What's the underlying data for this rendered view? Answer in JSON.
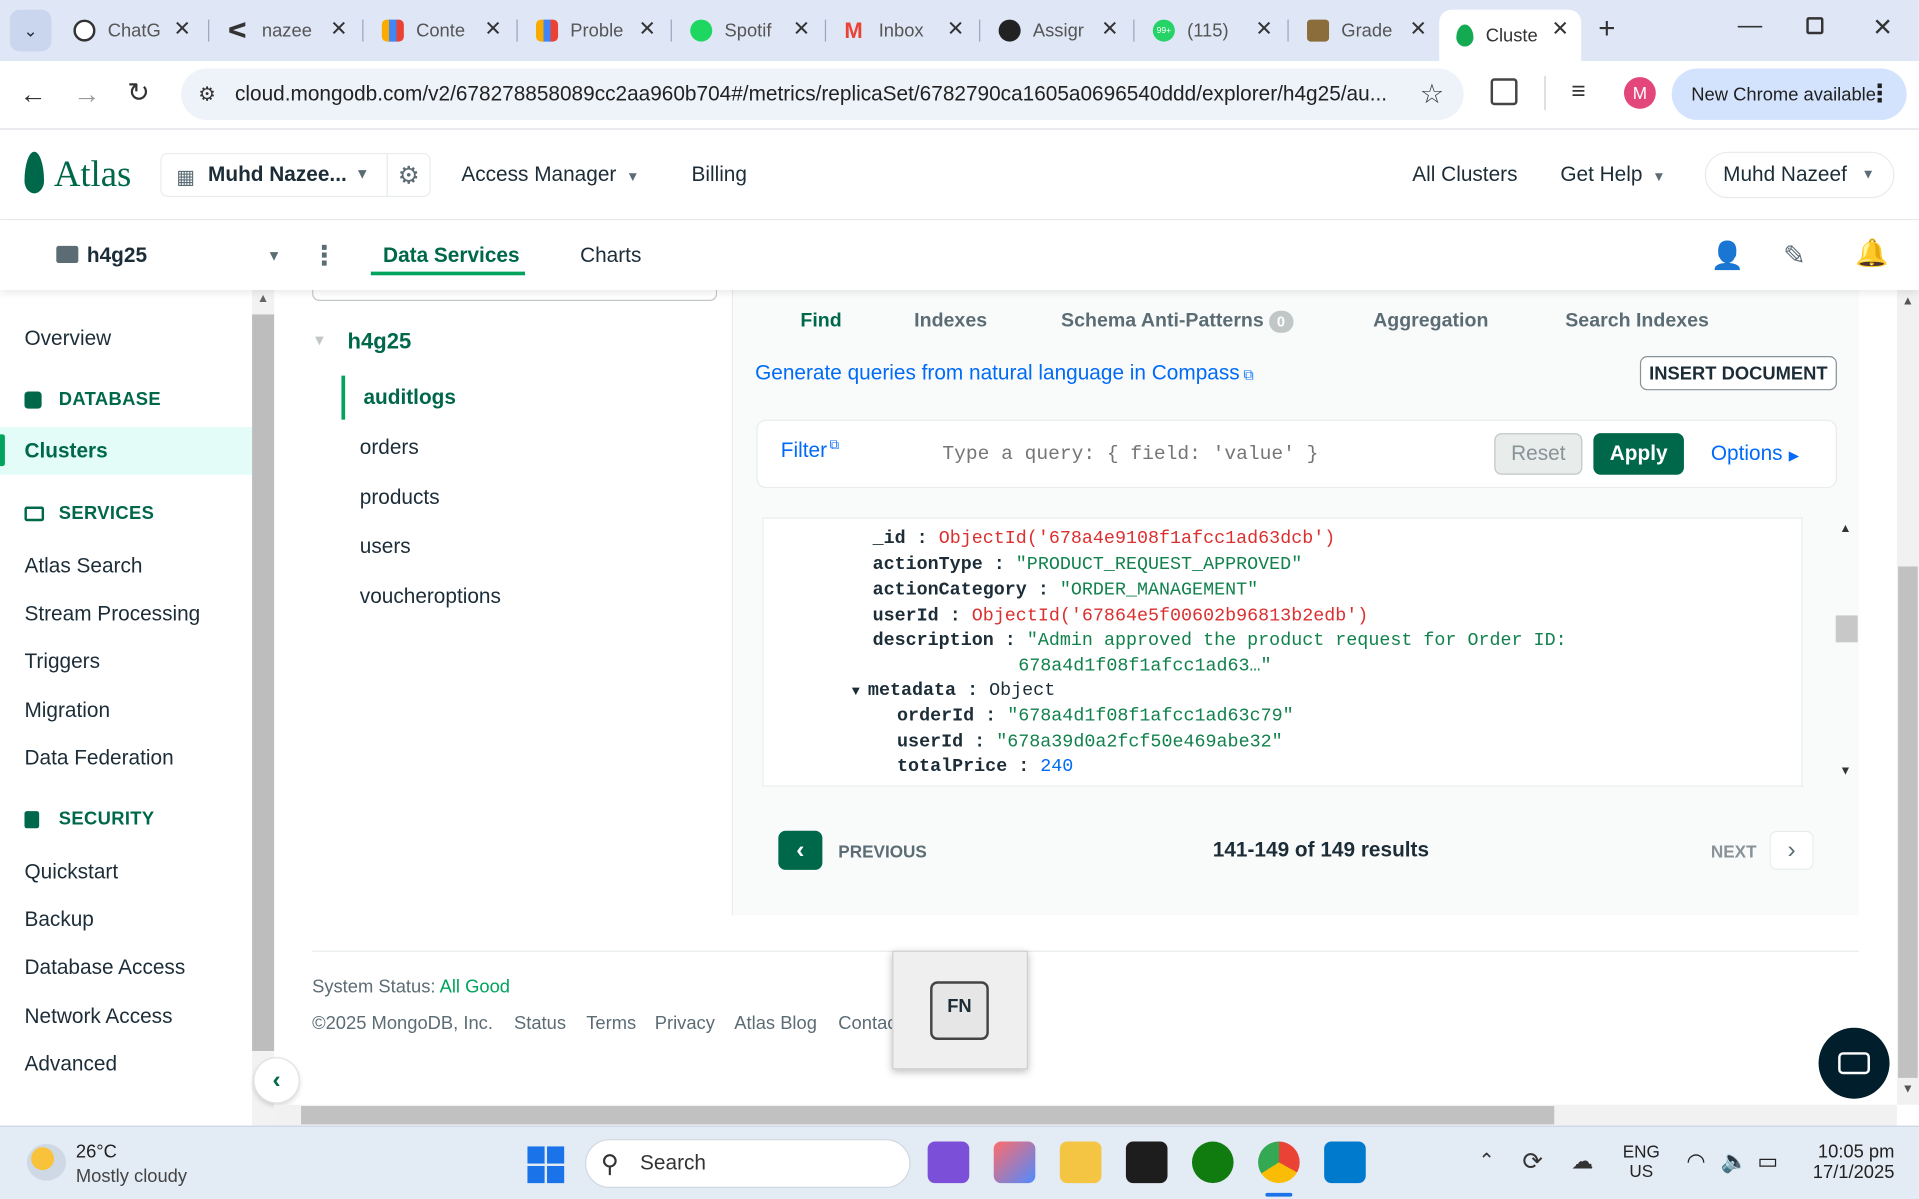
{
  "browser": {
    "tabs": [
      {
        "label": "ChatG",
        "icon": "chatgpt-icon"
      },
      {
        "label": "nazee",
        "icon": "leetcode-icon"
      },
      {
        "label": "Conte",
        "icon": "chart-icon"
      },
      {
        "label": "Proble",
        "icon": "chart-icon"
      },
      {
        "label": "Spotif",
        "icon": "spotify-icon"
      },
      {
        "label": "Inbox",
        "icon": "gmail-icon"
      },
      {
        "label": "Assigr",
        "icon": "github-icon"
      },
      {
        "label": "(115)",
        "icon": "whatsapp-icon"
      },
      {
        "label": "Grade",
        "icon": "university-icon"
      },
      {
        "label": "Cluste",
        "icon": "mongodb-leaf-icon"
      }
    ],
    "whatsapp_badge": "99+",
    "url": "cloud.mongodb.com/v2/678278858089cc2aa960b704#/metrics/replicaSet/6782790ca1605a0696540ddd/explorer/h4g25/au...",
    "profile_initial": "M",
    "new_chrome": "New Chrome available"
  },
  "atlas": {
    "logo": "Atlas",
    "org": "Muhd Nazee...",
    "access_manager": "Access Manager",
    "billing": "Billing",
    "all_clusters": "All Clusters",
    "get_help": "Get Help",
    "user": "Muhd Nazeef"
  },
  "project": {
    "name": "h4g25",
    "tabs": [
      "Data Services",
      "Charts"
    ]
  },
  "sidebar": {
    "overview": "Overview",
    "database_head": "DATABASE",
    "clusters": "Clusters",
    "services_head": "SERVICES",
    "services": [
      "Atlas Search",
      "Stream Processing",
      "Triggers",
      "Migration",
      "Data Federation"
    ],
    "security_head": "SECURITY",
    "security": [
      "Quickstart",
      "Backup",
      "Database Access",
      "Network Access",
      "Advanced"
    ]
  },
  "tree": {
    "database": "h4g25",
    "collections": [
      "auditlogs",
      "orders",
      "products",
      "users",
      "voucheroptions"
    ]
  },
  "main": {
    "tabs": [
      "Find",
      "Indexes",
      "Schema Anti-Patterns",
      "Aggregation",
      "Search Indexes"
    ],
    "anti_pattern_count": "0",
    "compass_link": "Generate queries from natural language in Compass",
    "insert_document": "INSERT DOCUMENT",
    "filter_label": "Filter",
    "filter_placeholder": "Type a query: { field: 'value' }",
    "reset": "Reset",
    "apply": "Apply",
    "options": "Options",
    "document": {
      "id_key": "_id",
      "id_val": "ObjectId('678a4e9108f1afcc1ad63dcb')",
      "action_type_key": "actionType",
      "action_type_val": "\"PRODUCT_REQUEST_APPROVED\"",
      "action_category_key": "actionCategory",
      "action_category_val": "\"ORDER_MANAGEMENT\"",
      "user_id_key": "userId",
      "user_id_val": "ObjectId('67864e5f00602b96813b2edb')",
      "description_key": "description",
      "description_val_1": "\"Admin approved the product request for Order ID:",
      "description_val_2": "678a4d1f08f1afcc1ad63…\"",
      "metadata_key": "metadata",
      "metadata_val": "Object",
      "order_id_key": "orderId",
      "order_id_val": "\"678a4d1f08f1afcc1ad63c79\"",
      "meta_user_id_key": "userId",
      "meta_user_id_val": "\"678a39d0a2fcf50e469abe32\"",
      "total_price_key": "totalPrice",
      "total_price_val": "240"
    },
    "previous": "PREVIOUS",
    "results": "141-149 of 149 results",
    "next": "NEXT"
  },
  "footer": {
    "status_label": "System Status:",
    "status_value": "All Good",
    "copyright": "©2025 MongoDB, Inc.",
    "links": [
      "Status",
      "Terms",
      "Privacy",
      "Atlas Blog",
      "Contact Sa"
    ]
  },
  "fn_key": "FN",
  "taskbar": {
    "temp": "26°C",
    "weather": "Mostly cloudy",
    "search": "Search",
    "lang_1": "ENG",
    "lang_2": "US",
    "time": "10:05 pm",
    "date": "17/1/2025"
  },
  "colors": {
    "mongo_green": "#00684a",
    "link_blue": "#016bf8",
    "string_green": "#12824d",
    "objectid_red": "#db3030"
  }
}
